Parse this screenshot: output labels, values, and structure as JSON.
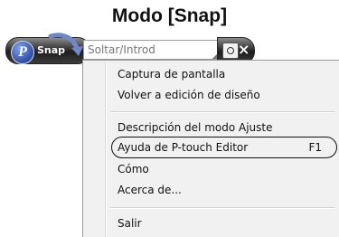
{
  "title": "Modo [Snap]",
  "toolbar": {
    "logo_letter": "P",
    "snap_label": "Snap",
    "search_placeholder": "Soltar/Introd",
    "camera_icon": "camera-icon",
    "close_glyph": "×"
  },
  "menu": {
    "items": [
      {
        "label": "Captura de pantalla",
        "shortcut": ""
      },
      {
        "label": "Volver a edición de diseño",
        "shortcut": ""
      },
      {
        "label": "Descripción del modo Ajuste",
        "shortcut": ""
      },
      {
        "label": "Ayuda de P-touch Editor",
        "shortcut": "F1",
        "highlighted": true
      },
      {
        "label": "Cómo",
        "shortcut": ""
      },
      {
        "label": "Acerca de...",
        "shortcut": ""
      },
      {
        "label": "Salir",
        "shortcut": ""
      }
    ]
  },
  "colors": {
    "menu_background": "#f1f1f1",
    "toolbar_dark": "#1e1e1e",
    "logo_blue": "#2f4fa8"
  }
}
